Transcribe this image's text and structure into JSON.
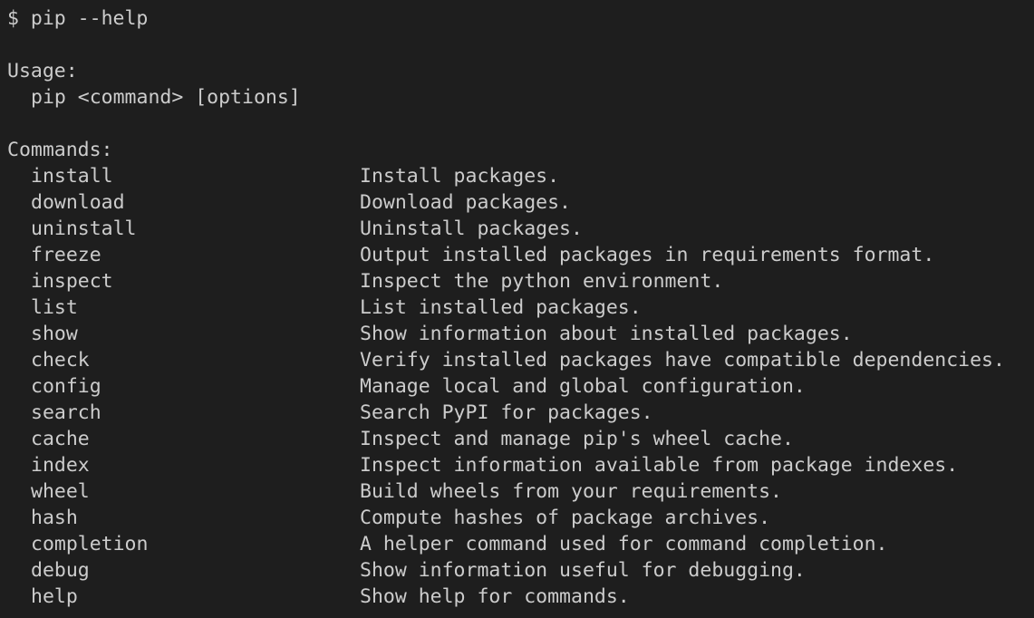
{
  "prompt": {
    "symbol": "$",
    "command": "pip --help"
  },
  "usage": {
    "heading": "Usage:",
    "syntax": "pip <command> [options]"
  },
  "commands": {
    "heading": "Commands:",
    "items": [
      {
        "name": "install",
        "desc": "Install packages."
      },
      {
        "name": "download",
        "desc": "Download packages."
      },
      {
        "name": "uninstall",
        "desc": "Uninstall packages."
      },
      {
        "name": "freeze",
        "desc": "Output installed packages in requirements format."
      },
      {
        "name": "inspect",
        "desc": "Inspect the python environment."
      },
      {
        "name": "list",
        "desc": "List installed packages."
      },
      {
        "name": "show",
        "desc": "Show information about installed packages."
      },
      {
        "name": "check",
        "desc": "Verify installed packages have compatible dependencies."
      },
      {
        "name": "config",
        "desc": "Manage local and global configuration."
      },
      {
        "name": "search",
        "desc": "Search PyPI for packages."
      },
      {
        "name": "cache",
        "desc": "Inspect and manage pip's wheel cache."
      },
      {
        "name": "index",
        "desc": "Inspect information available from package indexes."
      },
      {
        "name": "wheel",
        "desc": "Build wheels from your requirements."
      },
      {
        "name": "hash",
        "desc": "Compute hashes of package archives."
      },
      {
        "name": "completion",
        "desc": "A helper command used for command completion."
      },
      {
        "name": "debug",
        "desc": "Show information useful for debugging."
      },
      {
        "name": "help",
        "desc": "Show help for commands."
      }
    ]
  },
  "colors": {
    "background": "#1e1e1e",
    "foreground": "#cccccc"
  }
}
